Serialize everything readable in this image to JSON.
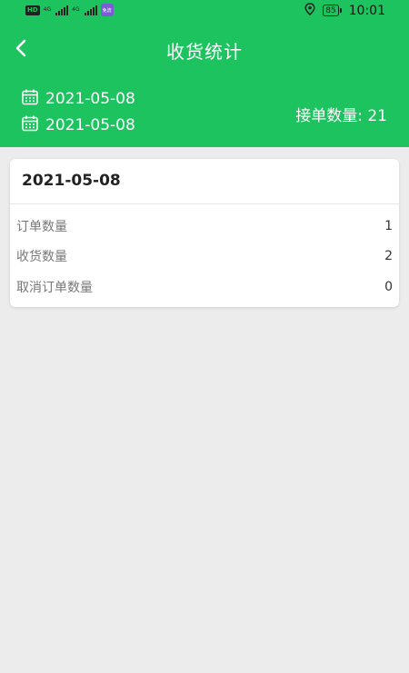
{
  "status_bar": {
    "network_badge": "HD",
    "signal_1_label": "4G",
    "signal_2_label": "4G",
    "app_badge_text": "免流",
    "battery": "85",
    "time": "10:01",
    "icons": [
      "location-icon",
      "battery-icon",
      "signal-icon"
    ]
  },
  "header": {
    "title": "收货统计",
    "back_icon": "chevron-left-icon",
    "start_date": "2021-05-08",
    "end_date": "2021-05-08",
    "date_icon": "calendar-icon",
    "order_count_text": "接单数量: 21"
  },
  "card": {
    "date": "2021-05-08",
    "rows": [
      {
        "label": "订单数量",
        "value": "1"
      },
      {
        "label": "收货数量",
        "value": "2"
      },
      {
        "label": "取消订单数量",
        "value": "0"
      }
    ]
  },
  "colors": {
    "accent": "#1dc35f",
    "background": "#ececec",
    "card": "#ffffff"
  }
}
